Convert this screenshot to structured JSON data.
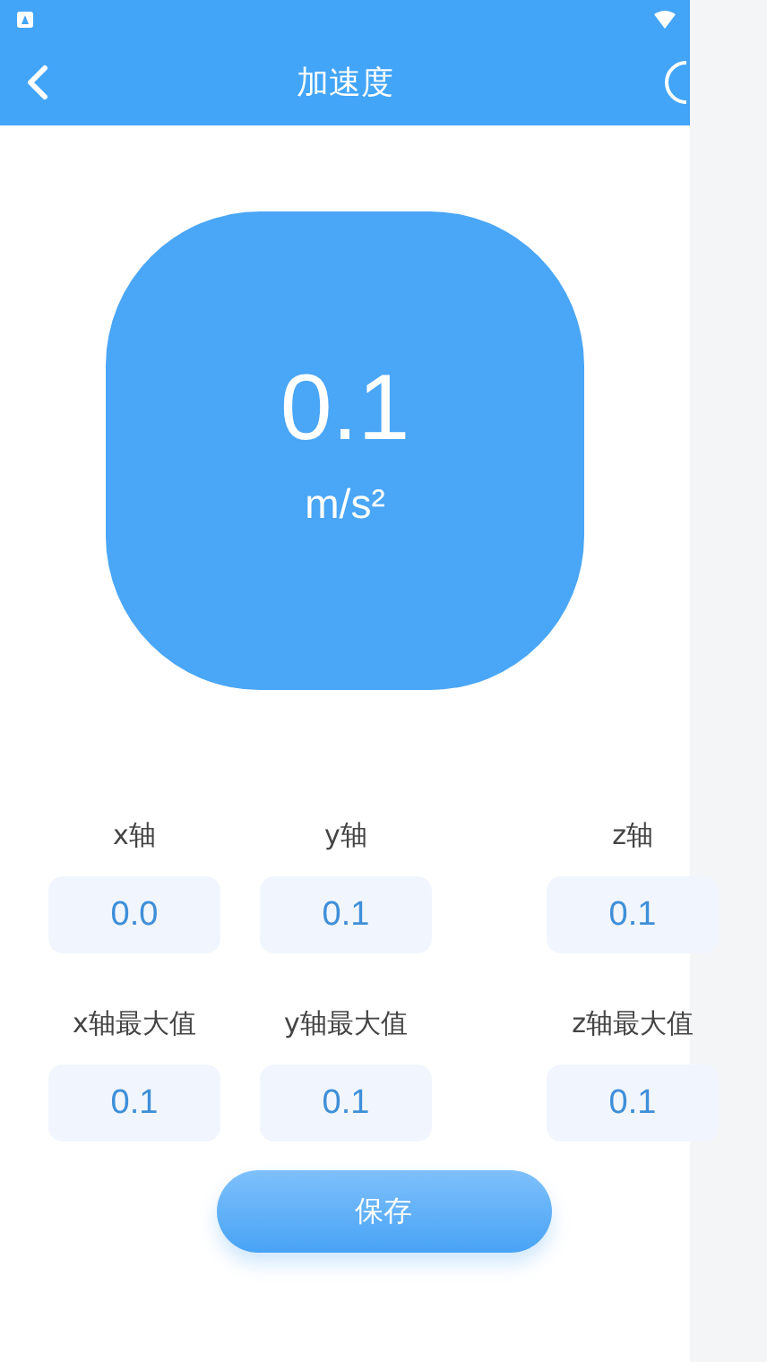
{
  "header": {
    "title": "加速度"
  },
  "reading": {
    "value": "0.1",
    "unit": "m/s²"
  },
  "fields": [
    {
      "label": "x轴",
      "value": "0.0"
    },
    {
      "label": "y轴",
      "value": "0.1"
    },
    {
      "label": "z轴",
      "value": "0.1"
    },
    {
      "label": "x轴最大值",
      "value": "0.1"
    },
    {
      "label": "y轴最大值",
      "value": "0.1"
    },
    {
      "label": "z轴最大值",
      "value": "0.1"
    }
  ],
  "save_button": "保存"
}
